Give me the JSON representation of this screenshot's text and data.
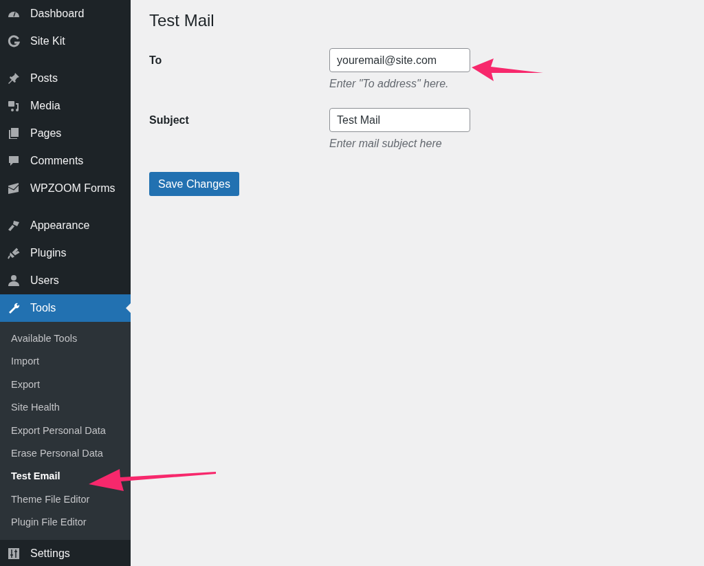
{
  "sidebar": {
    "groups": [
      [
        {
          "label": "Dashboard",
          "kind": "gauge",
          "selected": false
        },
        {
          "label": "Site Kit",
          "kind": "g",
          "selected": false
        }
      ],
      [
        {
          "label": "Posts",
          "kind": "pin",
          "selected": false
        },
        {
          "label": "Media",
          "kind": "media",
          "selected": false
        },
        {
          "label": "Pages",
          "kind": "pages",
          "selected": false
        },
        {
          "label": "Comments",
          "kind": "comment",
          "selected": false
        },
        {
          "label": "WPZOOM Forms",
          "kind": "mail",
          "selected": false
        }
      ],
      [
        {
          "label": "Appearance",
          "kind": "brush",
          "selected": false
        },
        {
          "label": "Plugins",
          "kind": "plug",
          "selected": false
        },
        {
          "label": "Users",
          "kind": "user",
          "selected": false
        },
        {
          "label": "Tools",
          "kind": "wrench",
          "selected": true,
          "children": [
            {
              "label": "Available Tools",
              "selected": false
            },
            {
              "label": "Import",
              "selected": false
            },
            {
              "label": "Export",
              "selected": false
            },
            {
              "label": "Site Health",
              "selected": false
            },
            {
              "label": "Export Personal Data",
              "selected": false
            },
            {
              "label": "Erase Personal Data",
              "selected": false
            },
            {
              "label": "Test Email",
              "selected": true
            },
            {
              "label": "Theme File Editor",
              "selected": false
            },
            {
              "label": "Plugin File Editor",
              "selected": false
            }
          ]
        },
        {
          "label": "Settings",
          "kind": "sliders",
          "selected": false
        }
      ]
    ]
  },
  "page": {
    "title": "Test Mail",
    "fields": [
      {
        "label": "To",
        "value": "youremail@site.com",
        "description": "Enter \"To address\" here."
      },
      {
        "label": "Subject",
        "value": "Test Mail",
        "description": "Enter mail subject here"
      }
    ],
    "button": "Save Changes"
  }
}
